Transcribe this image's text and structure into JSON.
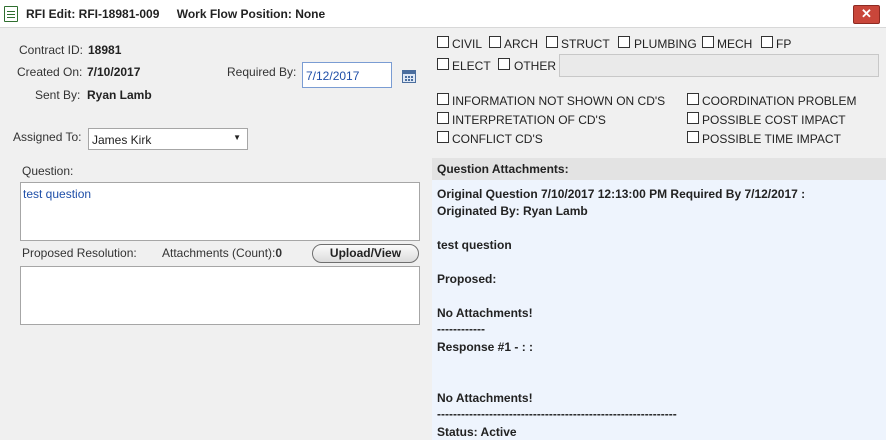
{
  "window": {
    "title_prefix": "RFI Edit:",
    "rfi_number": "RFI-18981-009",
    "workflow_label": "Work Flow Position:",
    "workflow_value": "None",
    "close_glyph": "✕"
  },
  "form": {
    "contract_id_label": "Contract ID:",
    "contract_id_value": "18981",
    "created_on_label": "Created On:",
    "created_on_value": "7/10/2017",
    "required_by_label": "Required By:",
    "required_by_value": "7/12/2017",
    "sent_by_label": "Sent By:",
    "sent_by_value": "Ryan Lamb",
    "assigned_to_label": "Assigned To:",
    "assigned_to_value": "James Kirk",
    "question_label": "Question:",
    "question_value": "test question",
    "proposed_resolution_label": "Proposed Resolution:",
    "proposed_resolution_value": "",
    "attachments_count_label": "Attachments (Count):",
    "attachments_count_value": "0",
    "upload_button": "Upload/View"
  },
  "disciplines": {
    "civil": "CIVIL",
    "arch": "ARCH",
    "struct": "STRUCT",
    "plumbing": "PLUMBING",
    "mech": "MECH",
    "fp": "FP",
    "elect": "ELECT",
    "other": "OTHER",
    "other_value": ""
  },
  "reasons": {
    "info_not_shown": "INFORMATION NOT SHOWN ON CD'S",
    "interpretation": "INTERPRETATION OF CD'S",
    "conflict": "CONFLICT CD'S",
    "coordination": "COORDINATION PROBLEM",
    "cost_impact": "POSSIBLE COST IMPACT",
    "time_impact": "POSSIBLE TIME IMPACT"
  },
  "attachments_panel": {
    "header": "Question Attachments:",
    "line1": "Original Question 7/10/2017 12:13:00 PM Required By 7/12/2017 :",
    "line2": "Originated By: Ryan Lamb",
    "line3": "test question",
    "line4": "Proposed:",
    "line5": "No Attachments!",
    "line6": "------------",
    "line7": "Response #1 - : :",
    "line8": "No Attachments!",
    "line9": "------------------------------------------------------------",
    "line10": "Status: Active"
  }
}
